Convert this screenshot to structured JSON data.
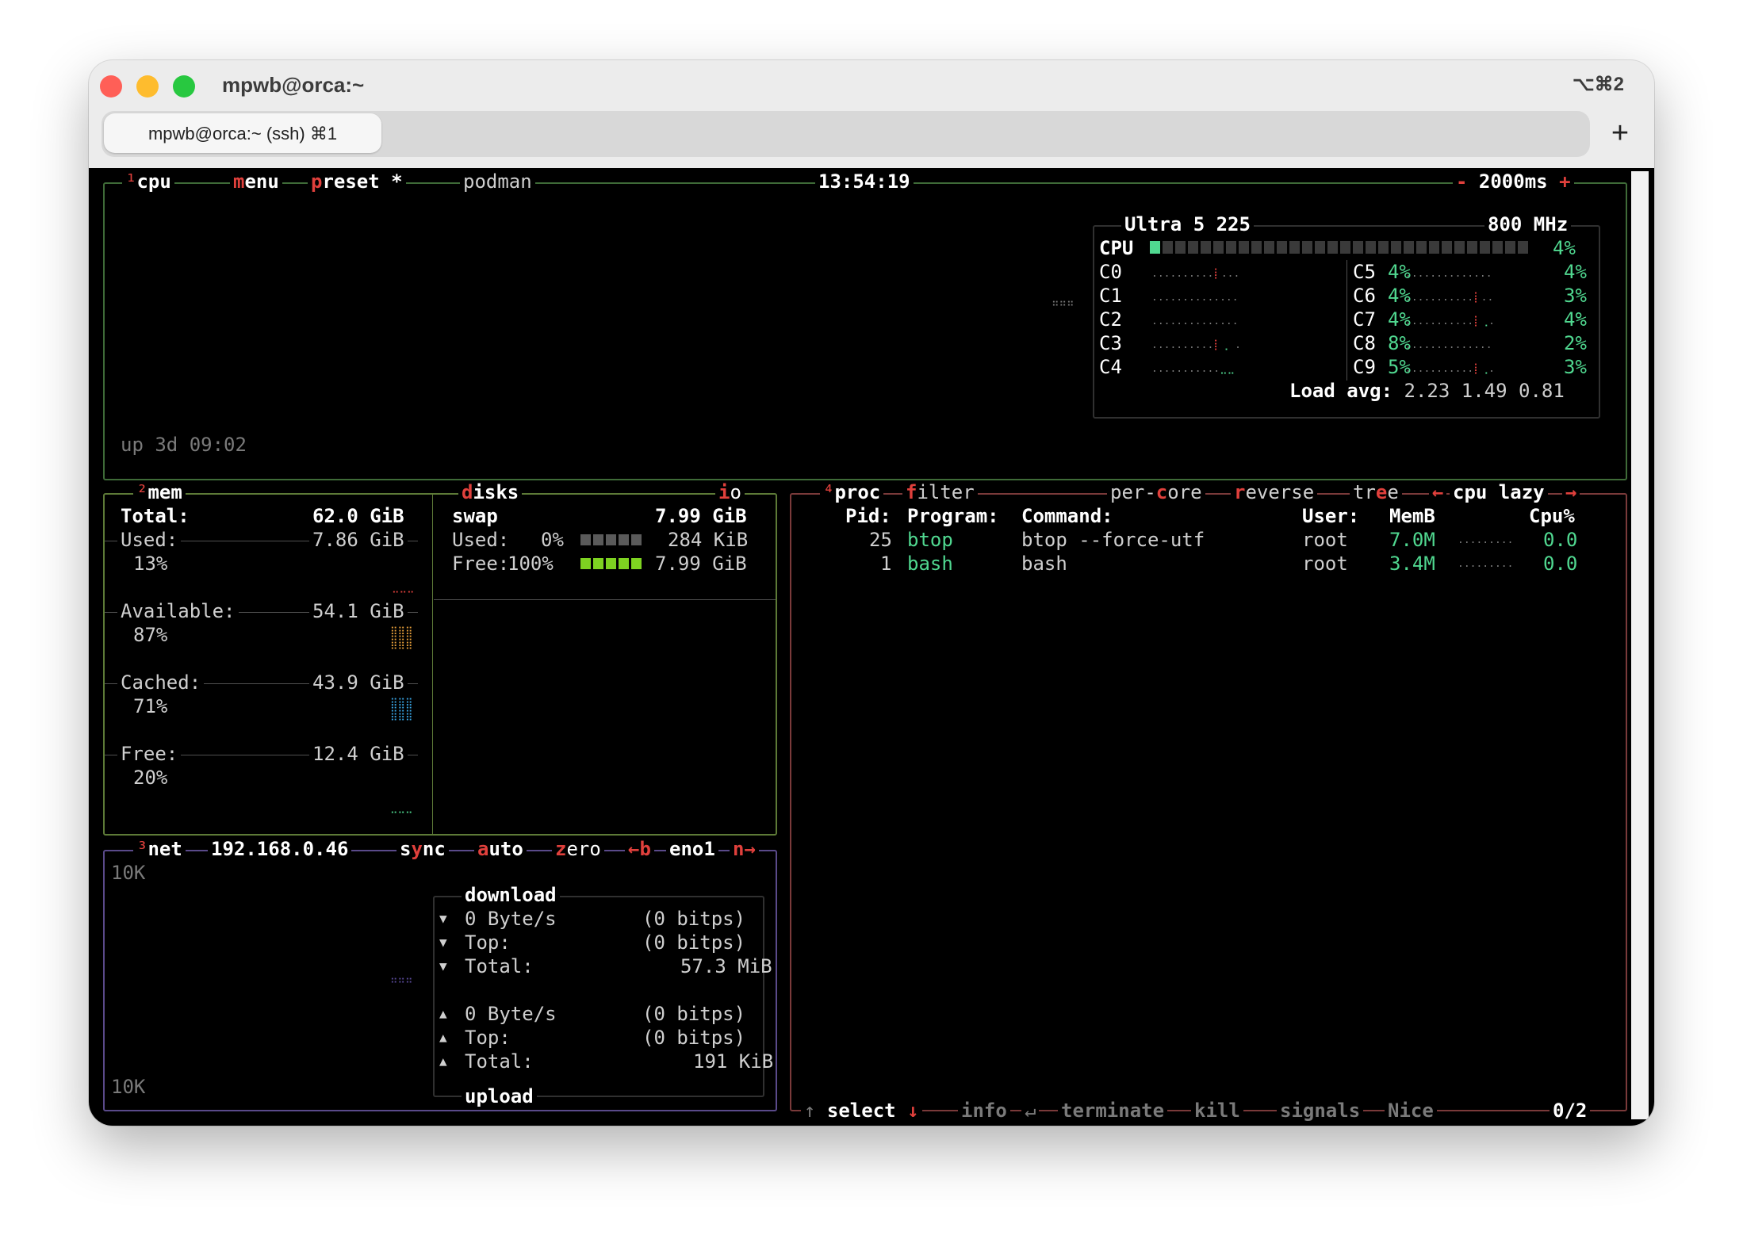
{
  "window": {
    "title": "mpwb@orca:~",
    "shortcut": "⌥⌘2",
    "tab_label": "mpwb@orca:~ (ssh) ⌘1",
    "new_tab": "+"
  },
  "cpu": {
    "num": "¹",
    "title": "cpu",
    "menu": "menu",
    "preset": "preset *",
    "container": "podman",
    "clock": "13:54:19",
    "minus": "-",
    "interval": "2000ms",
    "plus": "+",
    "uptime": "up 3d 09:02",
    "model": "Ultra 5 225",
    "freq": "800 MHz",
    "total_label": "CPU",
    "total_pct": "4%",
    "total_fraction": 0.04,
    "cores_left": [
      {
        "name": "C0",
        "pct": "4%"
      },
      {
        "name": "C1",
        "pct": "4%"
      },
      {
        "name": "C2",
        "pct": "4%"
      },
      {
        "name": "C3",
        "pct": "8%"
      },
      {
        "name": "C4",
        "pct": "5%"
      }
    ],
    "cores_right": [
      {
        "name": "C5",
        "pct": "4%"
      },
      {
        "name": "C6",
        "pct": "3%"
      },
      {
        "name": "C7",
        "pct": "4%"
      },
      {
        "name": "C8",
        "pct": "2%"
      },
      {
        "name": "C9",
        "pct": "3%"
      }
    ],
    "load_label": "Load avg:",
    "load_values": "2.23 1.49 0.81"
  },
  "mem": {
    "num": "²",
    "title": "mem",
    "total_label": "Total:",
    "total_value": "62.0 GiB",
    "used_label": "Used:",
    "used_value": "7.86 GiB",
    "used_pct": "13%",
    "available_label": "Available:",
    "available_value": "54.1 GiB",
    "available_pct": "87%",
    "cached_label": "Cached:",
    "cached_value": "43.9 GiB",
    "cached_pct": "71%",
    "free_label": "Free:",
    "free_value": "12.4 GiB",
    "free_pct": "20%"
  },
  "disks": {
    "title": "disks",
    "io": "io",
    "name": "swap",
    "size": "7.99 GiB",
    "used_label": "Used:",
    "used_pct": "0%",
    "used_value": "284 KiB",
    "free_label": "Free:",
    "free_pct": "100%",
    "free_value": "7.99 GiB",
    "used_fraction": 0.0,
    "free_fraction": 1.0
  },
  "net": {
    "num": "³",
    "title": "net",
    "ip": "192.168.0.46",
    "sync": "sync",
    "auto": "auto",
    "zero": "zero",
    "prev_key": "←b",
    "iface": "eno1",
    "next_key": "n→",
    "scale_top": "10K",
    "scale_bottom": "10K",
    "download_title": "download",
    "upload_title": "upload",
    "download_rows": [
      {
        "arrow": "▼",
        "label": "0 Byte/s",
        "value": "(0 bitps)"
      },
      {
        "arrow": "▼",
        "label": "Top:",
        "value": "(0 bitps)"
      },
      {
        "arrow": "▼",
        "label": "Total:",
        "value": "57.3 MiB"
      }
    ],
    "upload_rows": [
      {
        "arrow": "▲",
        "label": "0 Byte/s",
        "value": "(0 bitps)"
      },
      {
        "arrow": "▲",
        "label": "Top:",
        "value": "(0 bitps)"
      },
      {
        "arrow": "▲",
        "label": "Total:",
        "value": "191 KiB"
      }
    ]
  },
  "proc": {
    "num": "⁴",
    "title": "proc",
    "filter": "filter",
    "per_core": "per-core",
    "reverse": "reverse",
    "tree": "tree",
    "sort_left": "←",
    "sort": "cpu lazy",
    "sort_right": "→",
    "col_pid": "Pid:",
    "col_program": "Program:",
    "col_command": "Command:",
    "col_user": "User:",
    "col_memb": "MemB",
    "col_cpu": "Cpu%",
    "rows": [
      {
        "pid": "25",
        "program": "btop",
        "command": "btop --force-utf",
        "user": "root",
        "mem": "7.0M",
        "cpu": "0.0"
      },
      {
        "pid": "1",
        "program": "bash",
        "command": "bash",
        "user": "root",
        "mem": "3.4M",
        "cpu": "0.0"
      }
    ],
    "footer": {
      "up": "↑",
      "select": "select",
      "down": "↓",
      "info": "info",
      "enter": "↵",
      "terminate": "terminate",
      "kill": "kill",
      "signals": "signals",
      "nice": "Nice",
      "count": "0/2"
    }
  }
}
